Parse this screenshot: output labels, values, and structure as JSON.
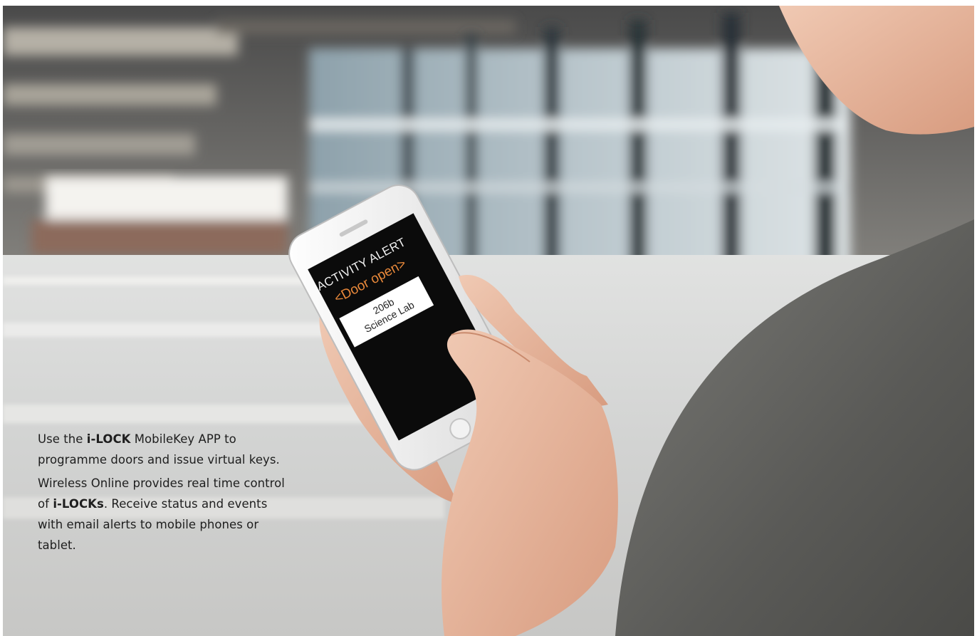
{
  "phone_screen": {
    "title": "ACTIVITY ALERT",
    "event": "<Door open>",
    "room_number": "206b",
    "room_name": "Science Lab"
  },
  "caption": {
    "paragraph_1": {
      "before": "Use the ",
      "bold": "i-LOCK",
      "after": " MobileKey APP to programme doors and issue virtual keys."
    },
    "paragraph_2": {
      "before": "Wireless Online provides real time control of ",
      "bold": "i-LOCKs",
      "after": ". Receive status and events with email alerts to mobile phones or tablet."
    }
  },
  "colors": {
    "accent_orange": "#e8883a",
    "caption_text": "#1e1e1e",
    "phone_screen_bg": "#0b0b0b"
  }
}
